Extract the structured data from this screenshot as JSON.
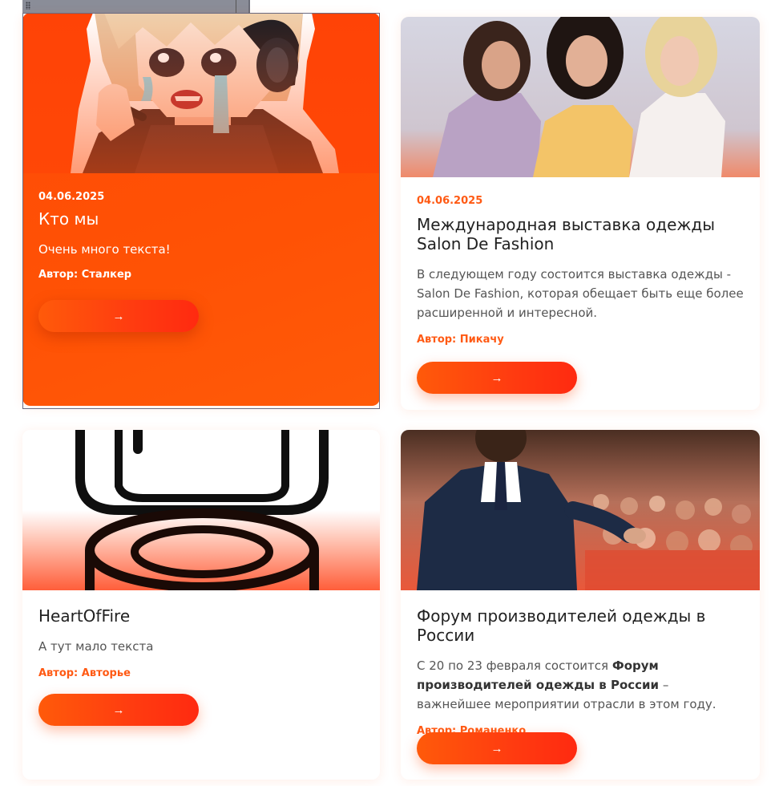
{
  "cards": [
    {
      "date": "04.06.2025",
      "title": "Кто мы",
      "text": "Очень много текста!",
      "author": "Автор: Сталкер",
      "button_icon": "arrow-right-icon"
    },
    {
      "date": "04.06.2025",
      "title": "Международная выставка одежды Salon De Fashion",
      "text": "В следующем году состоится выставка одежды - Salon De Fashion, которая обещает быть еще более расширенной и интересной.",
      "author": "Автор: Пикачу",
      "button_icon": "arrow-right-icon"
    },
    {
      "title": "HeartOfFire",
      "text": "А тут мало текста",
      "author": "Автор: Авторье",
      "button_icon": "arrow-right-icon"
    },
    {
      "title": "Форум производителей одежды в России",
      "text_before": "С 20 по 23 февраля состоится ",
      "text_bold": "Форум производителей одежды в России",
      "text_after": " – важнейшее мероприятии отрасли в этом году.",
      "author": "Автор: Романенко",
      "button_icon": "arrow-right-icon"
    }
  ],
  "colors": {
    "accent": "#ff5a14",
    "active_card": "#ff4e06",
    "button_start": "#ff5a0a",
    "button_end": "#ff2a10"
  },
  "arrow_glyph": "→"
}
